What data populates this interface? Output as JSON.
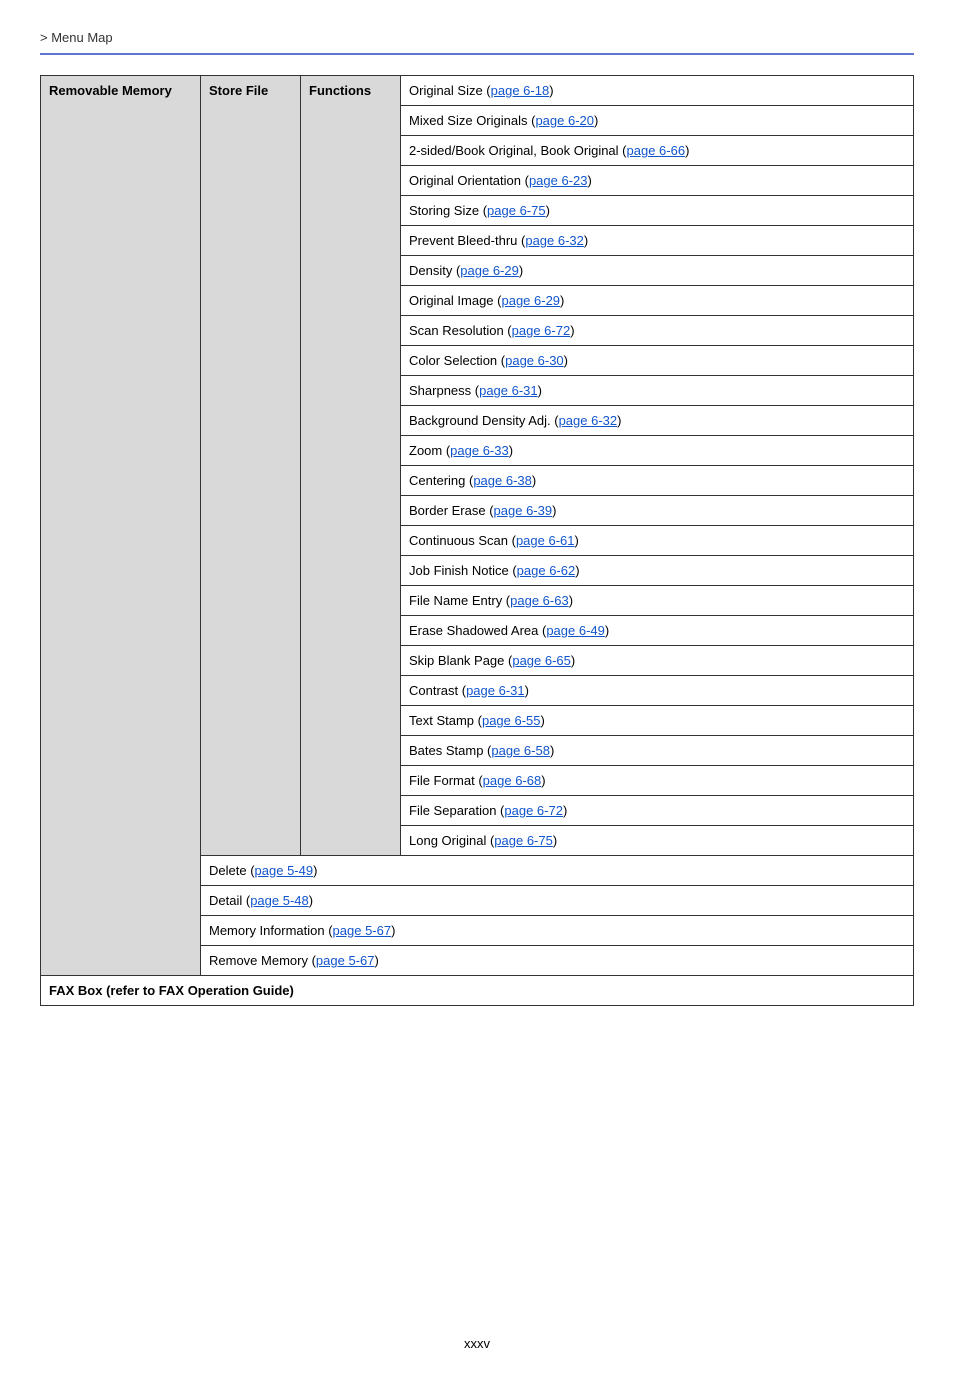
{
  "breadcrumb_prefix": "> ",
  "breadcrumb_text": "Menu Map",
  "col1_header": "Removable Memory",
  "col2_header": "Store File",
  "col3_header": "Functions",
  "functions": [
    {
      "label": "Original Size",
      "page": "page 6-18"
    },
    {
      "label": "Mixed Size Originals",
      "page": "page 6-20"
    },
    {
      "label": "2-sided/Book Original, Book Original",
      "page": "page 6-66"
    },
    {
      "label": "Original Orientation",
      "page": "page 6-23"
    },
    {
      "label": "Storing Size",
      "page": "page 6-75"
    },
    {
      "label": "Prevent Bleed-thru",
      "page": "page 6-32"
    },
    {
      "label": "Density",
      "page": "page 6-29"
    },
    {
      "label": "Original Image",
      "page": "page 6-29"
    },
    {
      "label": "Scan Resolution",
      "page": "page 6-72"
    },
    {
      "label": "Color Selection",
      "page": "page 6-30"
    },
    {
      "label": "Sharpness",
      "page": "page 6-31"
    },
    {
      "label": "Background Density Adj.",
      "page": "page 6-32"
    },
    {
      "label": "Zoom",
      "page": "page 6-33"
    },
    {
      "label": "Centering",
      "page": "page 6-38"
    },
    {
      "label": "Border Erase",
      "page": "page 6-39"
    },
    {
      "label": "Continuous Scan",
      "page": "page 6-61"
    },
    {
      "label": "Job Finish Notice",
      "page": "page 6-62"
    },
    {
      "label": "File Name Entry",
      "page": "page 6-63"
    },
    {
      "label": "Erase Shadowed Area",
      "page": "page 6-49"
    },
    {
      "label": "Skip Blank Page",
      "page": "page 6-65"
    },
    {
      "label": "Contrast",
      "page": "page 6-31"
    },
    {
      "label": "Text Stamp",
      "page": "page 6-55"
    },
    {
      "label": "Bates Stamp",
      "page": "page 6-58"
    },
    {
      "label": "File Format",
      "page": "page 6-68"
    },
    {
      "label": "File Separation",
      "page": "page 6-72"
    },
    {
      "label": "Long Original",
      "page": "page 6-75"
    }
  ],
  "sub_rows": [
    {
      "label": "Delete",
      "page": "page 5-49"
    },
    {
      "label": "Detail",
      "page": "page 5-48"
    },
    {
      "label": "Memory Information",
      "page": "page 5-67"
    },
    {
      "label": "Remove Memory",
      "page": "page 5-67"
    }
  ],
  "bottom_row": "FAX Box (refer to FAX Operation Guide)",
  "page_number": "xxxv"
}
